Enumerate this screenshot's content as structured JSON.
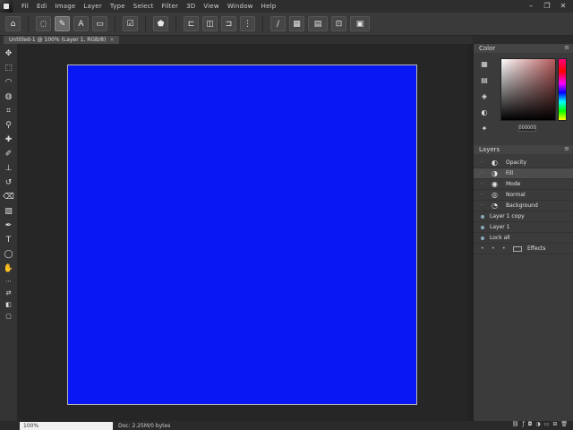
{
  "menu": {
    "items": [
      "Fil",
      "Edi",
      "Image",
      "Layer",
      "Type",
      "Select",
      "Filter",
      "3D",
      "View",
      "Window",
      "Help"
    ]
  },
  "window_controls": {
    "minimize": "–",
    "restore": "❐",
    "close": "✕"
  },
  "tab": {
    "label": "Untitled-1 @ 100% (Layer 1, RGB/8)",
    "close": "×"
  },
  "status": {
    "zoom": "100%",
    "doc_info": "Doc: 2.25M/0 bytes"
  },
  "color_panel": {
    "title": "Color",
    "hex": "000000"
  },
  "layers_panel": {
    "title": "Layers",
    "rows": [
      {
        "label": "Opacity"
      },
      {
        "label": "Fill"
      },
      {
        "label": "Mode"
      },
      {
        "label": "Normal"
      },
      {
        "label": "Background"
      },
      {
        "label": "Layer 1 copy"
      },
      {
        "label": "Layer 1"
      },
      {
        "label": "Lock all"
      },
      {
        "label": "Effects"
      }
    ]
  },
  "colors": {
    "canvas": "#0918f2"
  }
}
